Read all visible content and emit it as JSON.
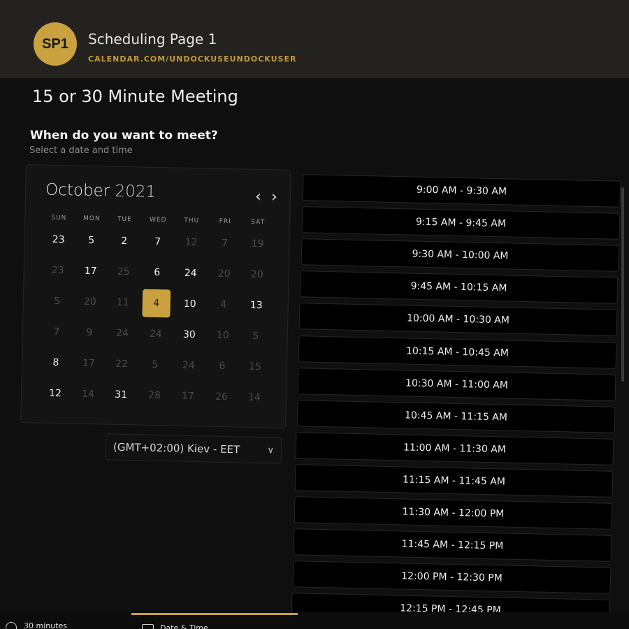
{
  "header": {
    "avatar_initials": "SP1",
    "page_name": "Scheduling Page 1",
    "page_url": "CALENDAR.COM/UNDOCKUSEUNDOCKUSER"
  },
  "meeting": {
    "title": "15 or 30 Minute Meeting",
    "question": "When do you want to meet?",
    "instruction": "Select a date and time"
  },
  "calendar": {
    "month": "October",
    "year": "2021",
    "prev_icon": "chevron-left-icon",
    "next_icon": "chevron-right-icon",
    "weekdays": [
      "SUN",
      "MON",
      "TUE",
      "WED",
      "THU",
      "FRI",
      "SAT"
    ],
    "weeks": [
      [
        {
          "d": "23",
          "s": "on"
        },
        {
          "d": "5",
          "s": "on"
        },
        {
          "d": "2",
          "s": "on"
        },
        {
          "d": "7",
          "s": "on"
        },
        {
          "d": "12",
          "s": "off"
        },
        {
          "d": "7",
          "s": "off"
        },
        {
          "d": "19",
          "s": "off"
        }
      ],
      [
        {
          "d": "23",
          "s": "off"
        },
        {
          "d": "17",
          "s": "on"
        },
        {
          "d": "25",
          "s": "off"
        },
        {
          "d": "6",
          "s": "on"
        },
        {
          "d": "24",
          "s": "on"
        },
        {
          "d": "20",
          "s": "off"
        },
        {
          "d": "20",
          "s": "off"
        }
      ],
      [
        {
          "d": "5",
          "s": "off"
        },
        {
          "d": "20",
          "s": "off"
        },
        {
          "d": "11",
          "s": "off"
        },
        {
          "d": "4",
          "s": "sel"
        },
        {
          "d": "10",
          "s": "on"
        },
        {
          "d": "4",
          "s": "off"
        },
        {
          "d": "13",
          "s": "on"
        }
      ],
      [
        {
          "d": "7",
          "s": "off"
        },
        {
          "d": "9",
          "s": "off"
        },
        {
          "d": "24",
          "s": "off"
        },
        {
          "d": "24",
          "s": "off"
        },
        {
          "d": "30",
          "s": "on"
        },
        {
          "d": "10",
          "s": "off"
        },
        {
          "d": "5",
          "s": "off"
        }
      ],
      [
        {
          "d": "8",
          "s": "on"
        },
        {
          "d": "17",
          "s": "off"
        },
        {
          "d": "22",
          "s": "off"
        },
        {
          "d": "5",
          "s": "off"
        },
        {
          "d": "24",
          "s": "off"
        },
        {
          "d": "6",
          "s": "off"
        },
        {
          "d": "15",
          "s": "off"
        }
      ],
      [
        {
          "d": "12",
          "s": "on"
        },
        {
          "d": "14",
          "s": "off"
        },
        {
          "d": "31",
          "s": "on"
        },
        {
          "d": "28",
          "s": "off"
        },
        {
          "d": "17",
          "s": "off"
        },
        {
          "d": "26",
          "s": "off"
        },
        {
          "d": "14",
          "s": "off"
        }
      ]
    ],
    "selected_color": "#c9a23f"
  },
  "timezone": {
    "value": "(GMT+02:00) Kiev - EET",
    "icon": "chevron-down-icon"
  },
  "slots": [
    "9:00 AM - 9:30 AM",
    "9:15 AM - 9:45 AM",
    "9:30 AM - 10:00 AM",
    "9:45 AM - 10:15 AM",
    "10:00 AM - 10:30 AM",
    "10:15 AM - 10:45 AM",
    "10:30 AM - 11:00 AM",
    "10:45 AM - 11:15 AM",
    "11:00 AM - 11:30 AM",
    "11:15 AM - 11:45 AM",
    "11:30 AM - 12:00 PM",
    "11:45 AM - 12:15 PM",
    "12:00 PM - 12:30 PM",
    "12:15 PM - 12:45 PM"
  ],
  "footer": {
    "duration_icon": "clock-icon",
    "duration": "30 minutes",
    "step_icon": "calendar-icon",
    "step": "Date & Time"
  },
  "colors": {
    "accent": "#c9a23f",
    "background": "#0f0f0f",
    "header": "#24221f"
  }
}
